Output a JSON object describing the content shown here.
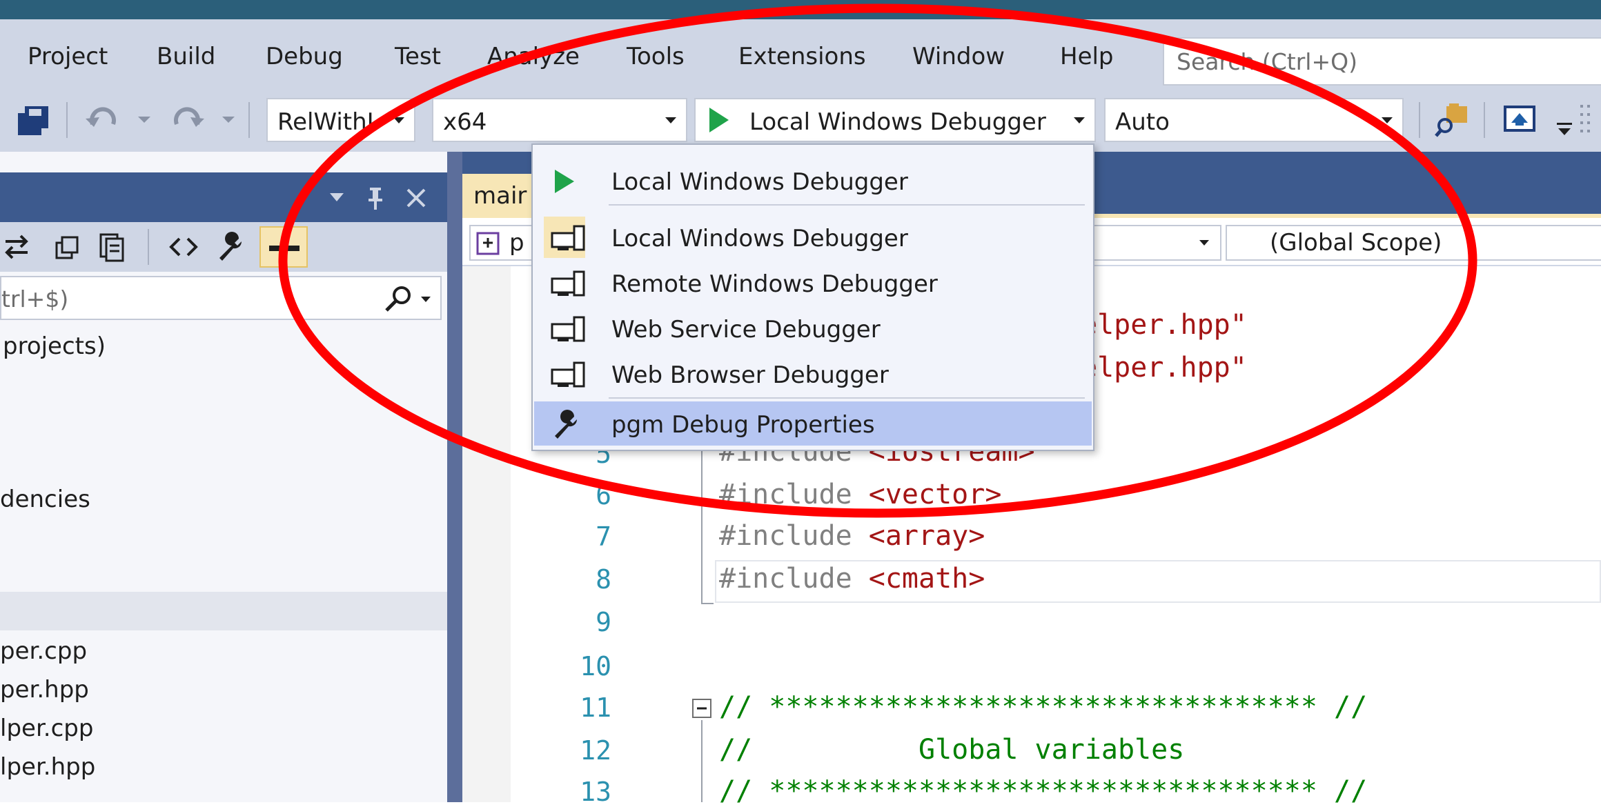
{
  "menu": {
    "items": [
      "Project",
      "Build",
      "Debug",
      "Test",
      "Analyze",
      "Tools",
      "Extensions",
      "Window",
      "Help"
    ]
  },
  "search": {
    "placeholder": "Search (Ctrl+Q)"
  },
  "toolbar": {
    "config": "RelWithI",
    "platform": "x64",
    "debugger": "Local Windows Debugger",
    "mode": "Auto"
  },
  "left_panel": {
    "search_hint": "trl+$)",
    "tree": [
      "projects)",
      "dencies",
      "per.cpp",
      "per.hpp",
      "lper.cpp",
      "lper.hpp"
    ]
  },
  "editor": {
    "tab": "mair",
    "nav_project": "p",
    "nav_scope": "(Global Scope)",
    "lines": [
      {
        "num": "5",
        "kw": "#include ",
        "arg": "<iostream>"
      },
      {
        "num": "6",
        "kw": "#include ",
        "arg": "<vector>"
      },
      {
        "num": "7",
        "kw": "#include ",
        "arg": "<array>"
      },
      {
        "num": "8",
        "kw": "#include ",
        "arg": "<cmath>"
      },
      {
        "num": "9",
        "text": ""
      },
      {
        "num": "10",
        "text": ""
      },
      {
        "num": "11",
        "comment": "// ********************************* //"
      },
      {
        "num": "12",
        "comment": "//          Global variables"
      },
      {
        "num": "13",
        "comment": "// ********************************* //"
      }
    ],
    "hidden_lines": {
      "line3": "elper.hpp\"",
      "line4": "elper.hpp\""
    }
  },
  "dropdown": {
    "items": [
      {
        "label": "Local Windows Debugger",
        "icon": "play-icon"
      },
      {
        "label": "Local Windows Debugger",
        "icon": "computer-icon"
      },
      {
        "label": "Remote Windows Debugger",
        "icon": "computer-icon"
      },
      {
        "label": "Web Service Debugger",
        "icon": "computer-icon"
      },
      {
        "label": "Web Browser Debugger",
        "icon": "computer-icon"
      },
      {
        "label": "pgm Debug Properties",
        "icon": "wrench-icon"
      }
    ]
  },
  "colors": {
    "accent_annotation": "#ff0000",
    "play_green": "#1fa34a",
    "string_red": "#a31515",
    "comment_green": "#008000",
    "line_number_blue": "#2b91af"
  }
}
